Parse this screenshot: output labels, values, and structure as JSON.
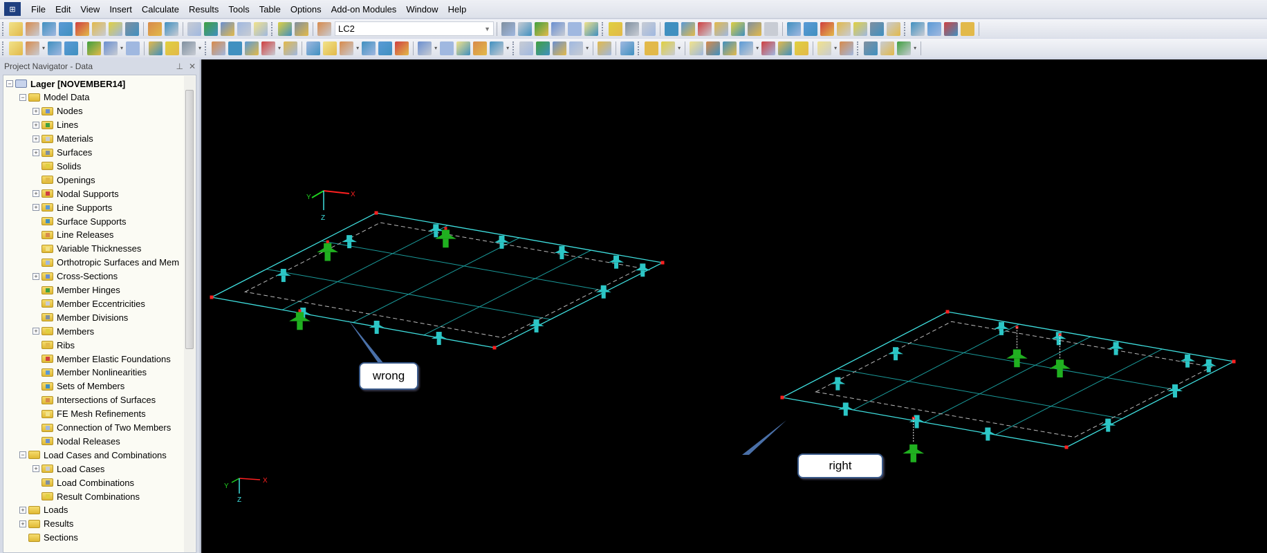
{
  "app": {
    "icon": "rfem-app-icon"
  },
  "menu": [
    "File",
    "Edit",
    "View",
    "Insert",
    "Calculate",
    "Results",
    "Tools",
    "Table",
    "Options",
    "Add-on Modules",
    "Window",
    "Help"
  ],
  "toolbar": {
    "load_case_value": "LC2"
  },
  "navigator": {
    "title": "Project Navigator - Data",
    "items": [
      {
        "label": "Lager [NOVEMBER14]",
        "level": 0,
        "toggle": "-",
        "bold": true
      },
      {
        "label": "Model Data",
        "level": 1,
        "toggle": "-"
      },
      {
        "label": "Nodes",
        "level": 2,
        "toggle": "+"
      },
      {
        "label": "Lines",
        "level": 2,
        "toggle": "+"
      },
      {
        "label": "Materials",
        "level": 2,
        "toggle": "+"
      },
      {
        "label": "Surfaces",
        "level": 2,
        "toggle": "+"
      },
      {
        "label": "Solids",
        "level": 2,
        "toggle": ""
      },
      {
        "label": "Openings",
        "level": 2,
        "toggle": ""
      },
      {
        "label": "Nodal Supports",
        "level": 2,
        "toggle": "+"
      },
      {
        "label": "Line Supports",
        "level": 2,
        "toggle": "+"
      },
      {
        "label": "Surface Supports",
        "level": 2,
        "toggle": ""
      },
      {
        "label": "Line Releases",
        "level": 2,
        "toggle": ""
      },
      {
        "label": "Variable Thicknesses",
        "level": 2,
        "toggle": ""
      },
      {
        "label": "Orthotropic Surfaces and Mem",
        "level": 2,
        "toggle": ""
      },
      {
        "label": "Cross-Sections",
        "level": 2,
        "toggle": "+"
      },
      {
        "label": "Member Hinges",
        "level": 2,
        "toggle": ""
      },
      {
        "label": "Member Eccentricities",
        "level": 2,
        "toggle": ""
      },
      {
        "label": "Member Divisions",
        "level": 2,
        "toggle": ""
      },
      {
        "label": "Members",
        "level": 2,
        "toggle": "+"
      },
      {
        "label": "Ribs",
        "level": 2,
        "toggle": ""
      },
      {
        "label": "Member Elastic Foundations",
        "level": 2,
        "toggle": ""
      },
      {
        "label": "Member Nonlinearities",
        "level": 2,
        "toggle": ""
      },
      {
        "label": "Sets of Members",
        "level": 2,
        "toggle": ""
      },
      {
        "label": "Intersections of Surfaces",
        "level": 2,
        "toggle": ""
      },
      {
        "label": "FE Mesh Refinements",
        "level": 2,
        "toggle": ""
      },
      {
        "label": "Connection of Two Members",
        "level": 2,
        "toggle": ""
      },
      {
        "label": "Nodal Releases",
        "level": 2,
        "toggle": ""
      },
      {
        "label": "Load Cases and Combinations",
        "level": 1,
        "toggle": "-"
      },
      {
        "label": "Load Cases",
        "level": 2,
        "toggle": "+"
      },
      {
        "label": "Load Combinations",
        "level": 2,
        "toggle": ""
      },
      {
        "label": "Result Combinations",
        "level": 2,
        "toggle": ""
      },
      {
        "label": "Loads",
        "level": 1,
        "toggle": "+"
      },
      {
        "label": "Results",
        "level": 1,
        "toggle": "+"
      },
      {
        "label": "Sections",
        "level": 1,
        "toggle": ""
      }
    ]
  },
  "viewport": {
    "axis_labels": {
      "x": "X",
      "y": "Y",
      "z": "Z"
    },
    "callouts": {
      "left": "wrong",
      "right": "right"
    }
  },
  "colors": {
    "edge": "#3fe0e0",
    "grid": "#1a9a9a",
    "support": "#2cc6c6",
    "support_green": "#20b020",
    "node": "#ff2020",
    "background": "#000000"
  }
}
